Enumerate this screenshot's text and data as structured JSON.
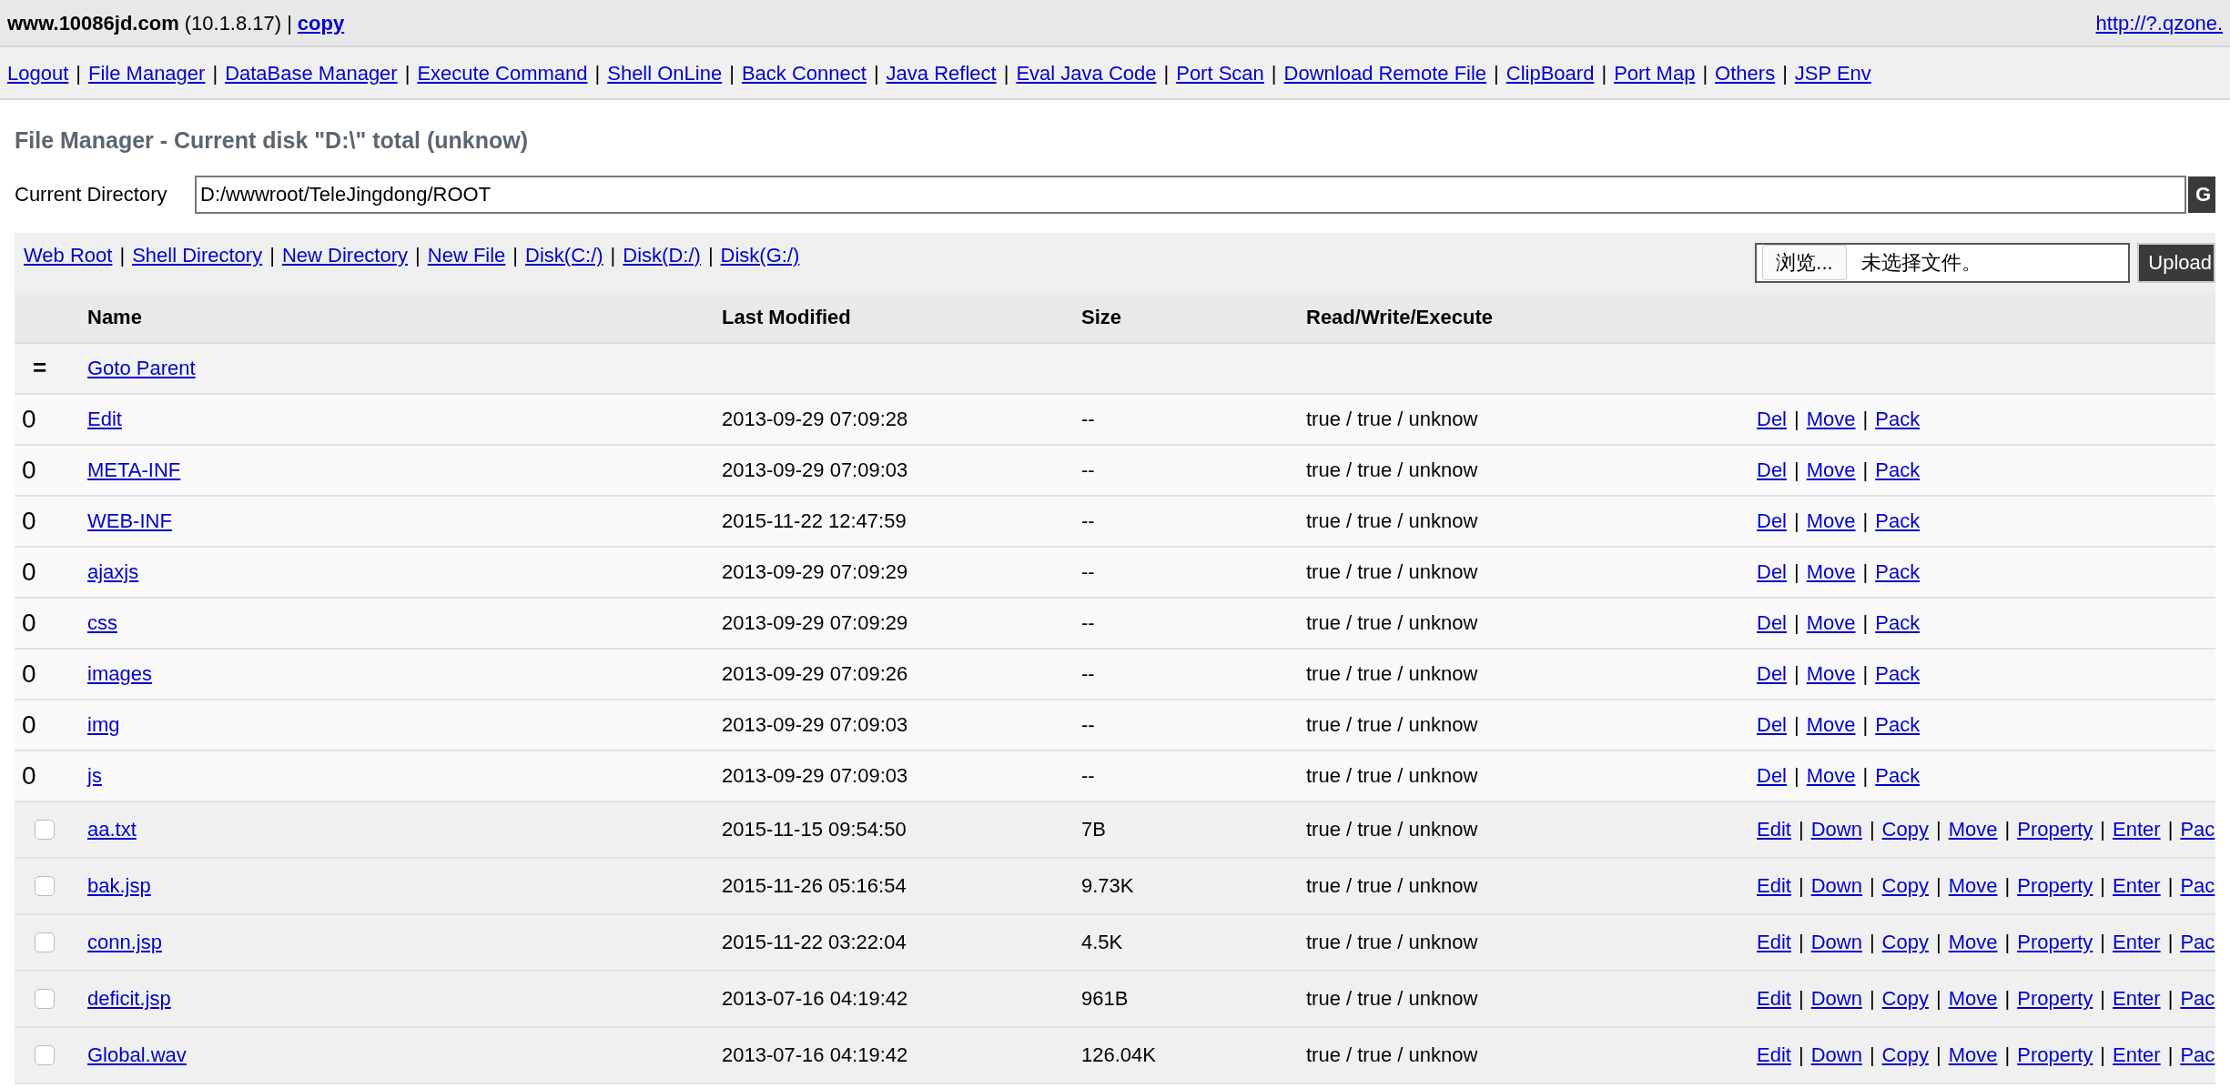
{
  "header": {
    "host": "www.10086jd.com",
    "ip": "(10.1.8.17)",
    "separator": "|",
    "copy_link": "copy",
    "right_link": "http://?.qzone."
  },
  "nav": [
    "Logout",
    "File Manager",
    "DataBase Manager",
    "Execute Command",
    "Shell OnLine",
    "Back Connect",
    "Java Reflect",
    "Eval Java Code",
    "Port Scan",
    "Download Remote File",
    "ClipBoard",
    "Port Map",
    "Others",
    "JSP Env"
  ],
  "title": "File Manager - Current disk \"D:\\\" total (unknow)",
  "directory": {
    "label": "Current Directory",
    "value": "D:/wwwroot/TeleJingdong/ROOT",
    "button": "G"
  },
  "toolbar": [
    "Web Root",
    "Shell Directory",
    "New Directory",
    "New File",
    "Disk(C:/)",
    "Disk(D:/)",
    "Disk(G:/)"
  ],
  "upload": {
    "browse": "浏览...",
    "status": "未选择文件。",
    "button": "Upload"
  },
  "table": {
    "columns": [
      "Name",
      "Last Modified",
      "Size",
      "Read/Write/Execute"
    ],
    "rows": [
      {
        "kind": "parent",
        "icon": "=",
        "name": "Goto Parent"
      },
      {
        "kind": "dir",
        "icon": "0",
        "name": "Edit",
        "modified": "2013-09-29 07:09:28",
        "size": "--",
        "rwx": "true / true / unknow",
        "actions": [
          "Del",
          "Move",
          "Pack"
        ]
      },
      {
        "kind": "dir",
        "icon": "0",
        "name": "META-INF",
        "modified": "2013-09-29 07:09:03",
        "size": "--",
        "rwx": "true / true / unknow",
        "actions": [
          "Del",
          "Move",
          "Pack"
        ]
      },
      {
        "kind": "dir",
        "icon": "0",
        "name": "WEB-INF",
        "modified": "2015-11-22 12:47:59",
        "size": "--",
        "rwx": "true / true / unknow",
        "actions": [
          "Del",
          "Move",
          "Pack"
        ]
      },
      {
        "kind": "dir",
        "icon": "0",
        "name": "ajaxjs",
        "modified": "2013-09-29 07:09:29",
        "size": "--",
        "rwx": "true / true / unknow",
        "actions": [
          "Del",
          "Move",
          "Pack"
        ]
      },
      {
        "kind": "dir",
        "icon": "0",
        "name": "css",
        "modified": "2013-09-29 07:09:29",
        "size": "--",
        "rwx": "true / true / unknow",
        "actions": [
          "Del",
          "Move",
          "Pack"
        ]
      },
      {
        "kind": "dir",
        "icon": "0",
        "name": "images",
        "modified": "2013-09-29 07:09:26",
        "size": "--",
        "rwx": "true / true / unknow",
        "actions": [
          "Del",
          "Move",
          "Pack"
        ]
      },
      {
        "kind": "dir",
        "icon": "0",
        "name": "img",
        "modified": "2013-09-29 07:09:03",
        "size": "--",
        "rwx": "true / true / unknow",
        "actions": [
          "Del",
          "Move",
          "Pack"
        ]
      },
      {
        "kind": "dir",
        "icon": "0",
        "name": "js",
        "modified": "2013-09-29 07:09:03",
        "size": "--",
        "rwx": "true / true / unknow",
        "actions": [
          "Del",
          "Move",
          "Pack"
        ]
      },
      {
        "kind": "file",
        "checked": false,
        "name": "aa.txt",
        "modified": "2015-11-15 09:54:50",
        "size": "7B",
        "rwx": "true / true / unknow",
        "actions": [
          "Edit",
          "Down",
          "Copy",
          "Move",
          "Property",
          "Enter",
          "Pac"
        ]
      },
      {
        "kind": "file",
        "checked": false,
        "name": "bak.jsp",
        "modified": "2015-11-26 05:16:54",
        "size": "9.73K",
        "rwx": "true / true / unknow",
        "actions": [
          "Edit",
          "Down",
          "Copy",
          "Move",
          "Property",
          "Enter",
          "Pac"
        ]
      },
      {
        "kind": "file",
        "checked": false,
        "name": "conn.jsp",
        "modified": "2015-11-22 03:22:04",
        "size": "4.5K",
        "rwx": "true / true / unknow",
        "actions": [
          "Edit",
          "Down",
          "Copy",
          "Move",
          "Property",
          "Enter",
          "Pac"
        ]
      },
      {
        "kind": "file",
        "checked": false,
        "name": "deficit.jsp",
        "modified": "2013-07-16 04:19:42",
        "size": "961B",
        "rwx": "true / true / unknow",
        "actions": [
          "Edit",
          "Down",
          "Copy",
          "Move",
          "Property",
          "Enter",
          "Pac"
        ]
      },
      {
        "kind": "file",
        "checked": false,
        "name": "Global.wav",
        "modified": "2013-07-16 04:19:42",
        "size": "126.04K",
        "rwx": "true / true / unknow",
        "actions": [
          "Edit",
          "Down",
          "Copy",
          "Move",
          "Property",
          "Enter",
          "Pac"
        ]
      }
    ]
  }
}
